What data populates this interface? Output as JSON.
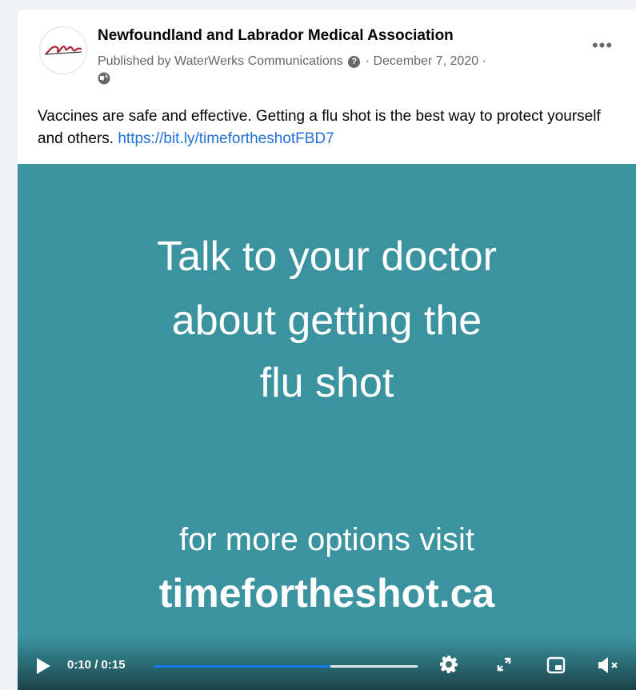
{
  "post": {
    "page_name": "Newfoundland and Labrador Medical Association",
    "published_by": "Published by WaterWerks Communications",
    "help_glyph": "?",
    "separator": "·",
    "date": "December 7, 2020",
    "audience_icon": "globe-icon",
    "more_label": "•••",
    "caption_text": "Vaccines are safe and effective. Getting a flu shot is the best way to protect yourself and others.",
    "caption_link": "https://bit.ly/timefortheshotFBD7"
  },
  "video": {
    "line1": "Talk to your doctor",
    "line2": "about getting the",
    "line3": "flu shot",
    "line4": "for more options visit",
    "line5": "timefortheshot.ca",
    "time_display": "0:10 / 0:15",
    "progress": 0.67,
    "background_color": "#3a939f",
    "icons": [
      "play-icon",
      "settings-icon",
      "fullscreen-icon",
      "picture-in-picture-icon",
      "mute-icon"
    ]
  },
  "colors": {
    "link": "#216fdb",
    "progress": "#1877f2"
  }
}
